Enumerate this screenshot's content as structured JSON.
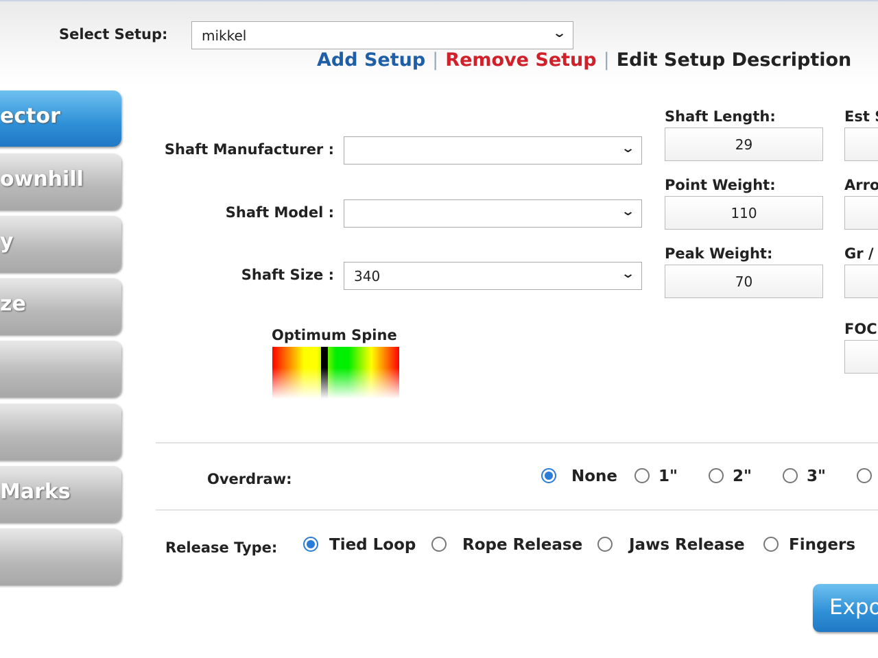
{
  "header": {
    "select_label": "Select Setup:",
    "setup_value": "mikkel",
    "add_setup": "Add Setup",
    "remove_setup": "Remove Setup",
    "edit_description": "Edit Setup Description",
    "separator": "|",
    "add_color": "#1f5fa8",
    "remove_color": "#d0202a"
  },
  "sidebar": {
    "items": [
      {
        "label": "ector",
        "active": true
      },
      {
        "label": "ownhill"
      },
      {
        "label": "y"
      },
      {
        "label": "ze"
      },
      {
        "label": ""
      },
      {
        "label": ""
      },
      {
        "label": "Marks"
      },
      {
        "label": ""
      }
    ]
  },
  "shaft": {
    "manufacturer_label": "Shaft Manufacturer :",
    "manufacturer_value": "",
    "model_label": "Shaft Model :",
    "model_value": "",
    "size_label": "Shaft Size :",
    "size_value": "340"
  },
  "fields": {
    "shaft_length": {
      "label": "Shaft Length:",
      "value": "29"
    },
    "point_weight": {
      "label": "Point Weight:",
      "value": "110"
    },
    "peak_weight": {
      "label": "Peak Weight:",
      "value": "70"
    },
    "est": {
      "label": "Est S",
      "value": ""
    },
    "arrow": {
      "label": "Arro",
      "value": ""
    },
    "gr": {
      "label": "Gr /",
      "value": ""
    },
    "foc": {
      "label": "FOC",
      "value": ""
    }
  },
  "spine": {
    "label": "Optimum Spine",
    "indicator_fraction": 0.41
  },
  "overdraw": {
    "label": "Overdraw:",
    "options": [
      "None",
      "1\"",
      "2\"",
      "3\"",
      ""
    ],
    "selected": 0
  },
  "release": {
    "label": "Release Type:",
    "options": [
      "Tied Loop",
      "Rope Release",
      "Jaws Release",
      "Fingers"
    ],
    "selected": 0
  },
  "export_label": "Expo"
}
